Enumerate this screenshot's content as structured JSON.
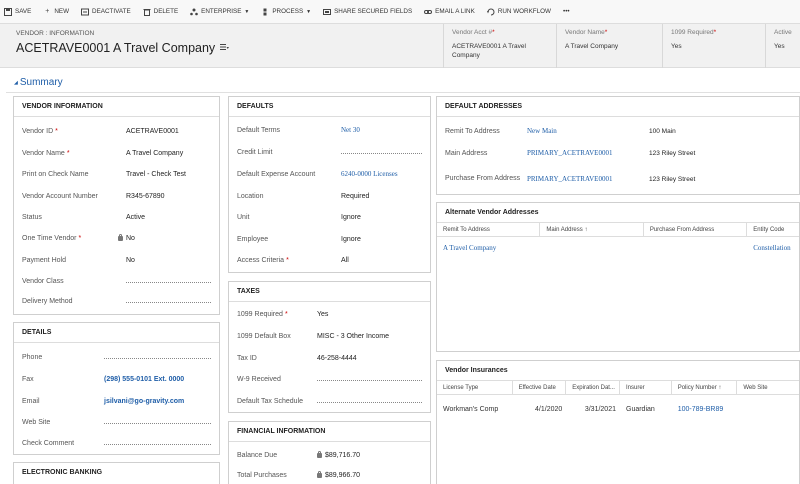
{
  "toolbar": {
    "save": "SAVE",
    "new": "NEW",
    "deactivate": "DEACTIVATE",
    "delete": "DELETE",
    "enterprise": "ENTERPRISE",
    "process": "PROCESS",
    "share": "SHARE SECURED FIELDS",
    "email": "EMAIL A LINK",
    "workflow": "RUN WORKFLOW",
    "more": "•••"
  },
  "header": {
    "crumb": "VENDOR : INFORMATION",
    "title": "ACETRAVE0001 A Travel Company",
    "fields": [
      {
        "label": "Vendor Acct #",
        "value": "ACETRAVE0001 A Travel Company"
      },
      {
        "label": "Vendor Name",
        "value": "A Travel Company"
      },
      {
        "label": "1099 Required",
        "value": "Yes"
      },
      {
        "label": "Active",
        "value": "Yes"
      }
    ]
  },
  "summary": "Summary",
  "vendor_info": {
    "title": "VENDOR INFORMATION",
    "rows": [
      {
        "label": "Vendor ID",
        "value": "ACETRAVE0001"
      },
      {
        "label": "Vendor Name",
        "value": "A Travel Company"
      },
      {
        "label": "Print on Check Name",
        "value": "Travel - Check Test"
      },
      {
        "label": "Vendor Account Number",
        "value": "R345-67890"
      },
      {
        "label": "Status",
        "value": "Active"
      },
      {
        "label": "One Time Vendor",
        "value": "No"
      },
      {
        "label": "Payment Hold",
        "value": "No"
      },
      {
        "label": "Vendor Class",
        "value": ""
      },
      {
        "label": "Delivery Method",
        "value": ""
      }
    ]
  },
  "details": {
    "title": "DETAILS",
    "rows": [
      {
        "label": "Phone",
        "value": ""
      },
      {
        "label": "Fax",
        "value": "(298) 555-0101 Ext. 0000"
      },
      {
        "label": "Email",
        "value": "jsilvani@go-gravity.com"
      },
      {
        "label": "Web Site",
        "value": ""
      },
      {
        "label": "Check Comment",
        "value": ""
      }
    ]
  },
  "banking": {
    "title": "ELECTRONIC BANKING"
  },
  "defaults": {
    "title": "DEFAULTS",
    "rows": [
      {
        "label": "Default Terms",
        "value": "Net 30"
      },
      {
        "label": "Credit Limit",
        "value": ""
      },
      {
        "label": "Default Expense Account",
        "value": "6240-0000 Licenses"
      },
      {
        "label": "Location",
        "value": "Required"
      },
      {
        "label": "Unit",
        "value": "Ignore"
      },
      {
        "label": "Employee",
        "value": "Ignore"
      },
      {
        "label": "Access Criteria",
        "value": "All"
      }
    ]
  },
  "taxes": {
    "title": "TAXES",
    "rows": [
      {
        "label": "1099 Required",
        "value": "Yes"
      },
      {
        "label": "1099 Default Box",
        "value": "MISC - 3 Other Income"
      },
      {
        "label": "Tax ID",
        "value": "46-258-4444"
      },
      {
        "label": "W-9 Received",
        "value": ""
      },
      {
        "label": "Default Tax Schedule",
        "value": ""
      }
    ]
  },
  "financial": {
    "title": "FINANCIAL INFORMATION",
    "rows": [
      {
        "label": "Balance Due",
        "value": "$89,716.70"
      },
      {
        "label": "Total Purchases",
        "value": "$89,966.70"
      }
    ]
  },
  "addresses": {
    "title": "DEFAULT ADDRESSES",
    "rows": [
      {
        "label": "Remit To Address",
        "link": "New Main",
        "addr": "100 Main"
      },
      {
        "label": "Main Address",
        "link": "PRIMARY_ACETRAVE0001",
        "addr": "123 Riley Street"
      },
      {
        "label": "Purchase From Address",
        "link": "PRIMARY_ACETRAVE0001",
        "addr": "123 Riley Street"
      }
    ]
  },
  "alt_addresses": {
    "title": "Alternate Vendor Addresses",
    "columns": [
      "Remit To Address",
      "Main Address ↑",
      "Purchase From Address",
      "Entity Code"
    ],
    "row": {
      "remit": "A Travel Company",
      "entity": "Constellation"
    }
  },
  "insurances": {
    "title": "Vendor Insurances",
    "columns": [
      "License Type",
      "Effective Date",
      "Expiration Dat...",
      "Insurer",
      "Policy Number ↑",
      "Web Site"
    ],
    "row": {
      "type": "Workman's Comp",
      "effective": "4/1/2020",
      "expiration": "3/31/2021",
      "insurer": "Guardian",
      "policy": "100-789-BR89",
      "site": ""
    }
  }
}
